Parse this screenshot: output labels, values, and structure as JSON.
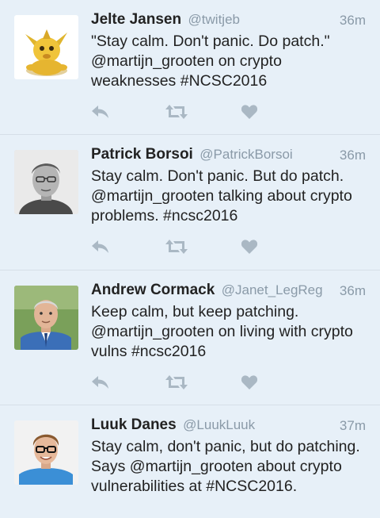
{
  "tweets": [
    {
      "name": "Jelte Jansen",
      "handle": "@twitjeb",
      "time": "36m",
      "text": "\"Stay calm. Don't panic. Do patch.\" @martijn_grooten on crypto weaknesses #NCSC2016"
    },
    {
      "name": "Patrick Borsoi",
      "handle": "@PatrickBorsoi",
      "time": "36m",
      "text": "Stay calm. Don't panic. But do patch. @martijn_grooten talking about crypto problems. #ncsc2016"
    },
    {
      "name": "Andrew Cormack",
      "handle": "@Janet_LegReg",
      "time": "36m",
      "text": "Keep calm, but keep patching. @martijn_grooten on living with crypto vulns #ncsc2016"
    },
    {
      "name": "Luuk Danes",
      "handle": "@LuukLuuk",
      "time": "37m",
      "text": "Stay calm, don't panic, but do patching. Says @martijn_grooten about crypto vulnerabilities at #NCSC2016."
    }
  ],
  "icons": {
    "reply": "reply-icon",
    "retweet": "retweet-icon",
    "like": "heart-icon"
  },
  "colors": {
    "background": "#e7f0f8",
    "meta_text": "#8a9aa8",
    "action_icon": "#aab8c4"
  }
}
